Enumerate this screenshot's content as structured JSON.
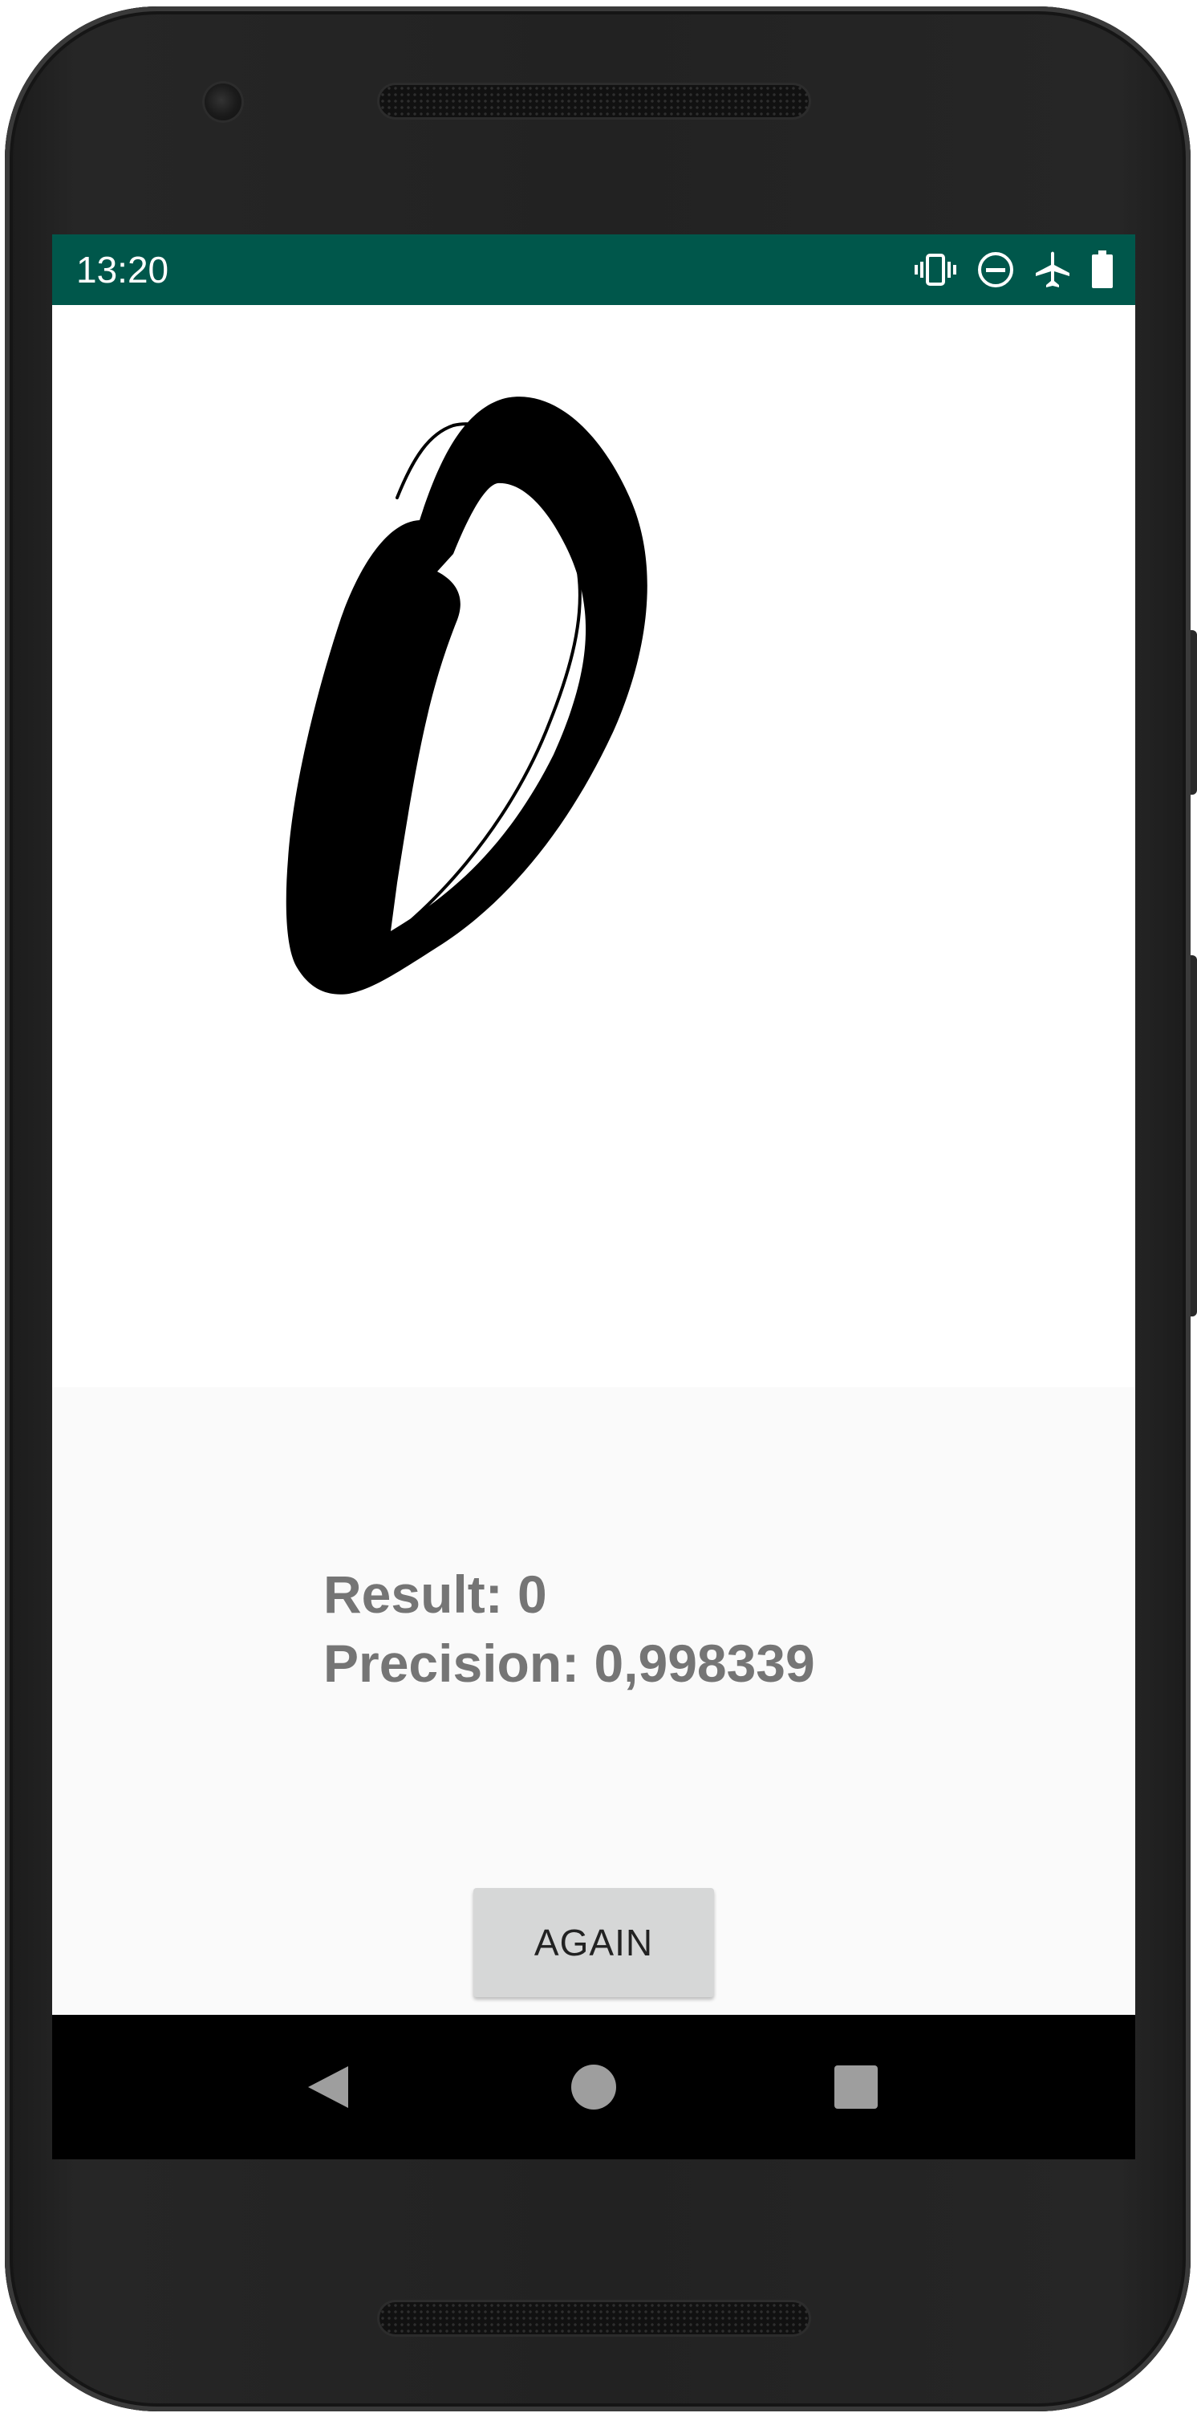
{
  "status_bar": {
    "time": "13:20",
    "background": "#00574b",
    "icons": [
      "vibrate-icon",
      "do-not-disturb-icon",
      "airplane-mode-icon",
      "battery-icon"
    ]
  },
  "drawing": {
    "description_icon": "handwritten-digit-stroke",
    "stroke_color": "#000000"
  },
  "result": {
    "result_text": "Result: 0",
    "precision_text": "Precision: 0,998339",
    "text_color": "#757575"
  },
  "actions": {
    "again_label": "AGAIN"
  },
  "navigation": {
    "items": [
      "back-icon",
      "home-icon",
      "recents-icon"
    ]
  }
}
